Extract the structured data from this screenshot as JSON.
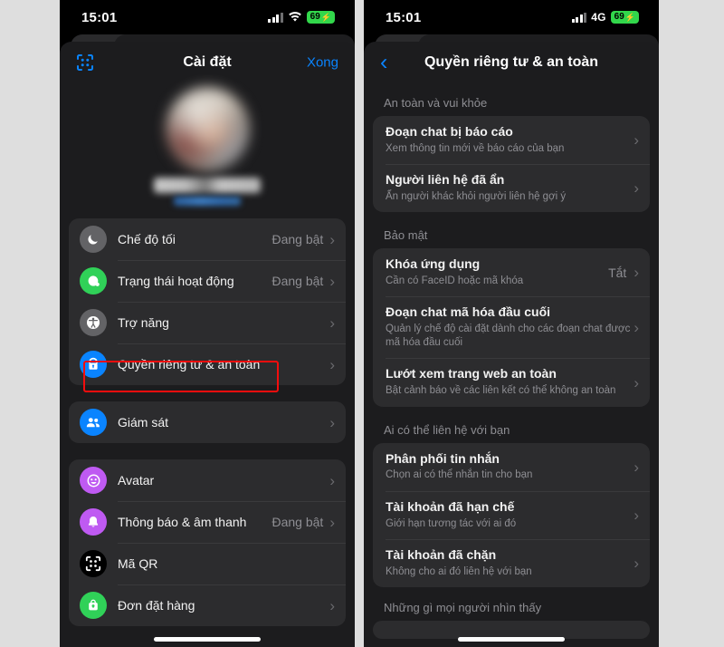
{
  "background_color": "#dedede",
  "left_phone": {
    "status_bar": {
      "time": "15:01",
      "network": "",
      "battery": "69",
      "battery_charging": true,
      "signal_icon": "cellular-signal-icon",
      "wifi_icon": "wifi-icon",
      "battery_icon": "battery-icon"
    },
    "nav": {
      "left_icon": "qr-code-icon",
      "title": "Cài đặt",
      "right_label": "Xong"
    },
    "profile": {
      "avatar": "blurred-profile-photo",
      "name": "blurred-name",
      "handle": "blurred-username"
    },
    "groups": [
      {
        "rows": [
          {
            "icon": "moon-icon",
            "icon_color": "#636366",
            "label": "Chế độ tối",
            "value": "Đang bật",
            "chevron": "chevron-right-icon"
          },
          {
            "icon": "active-status-icon",
            "icon_color": "#30d158",
            "label": "Trạng thái hoạt động",
            "value": "Đang bật",
            "chevron": "chevron-right-icon"
          },
          {
            "icon": "accessibility-icon",
            "icon_color": "#636366",
            "label": "Trợ năng",
            "value": "",
            "chevron": "chevron-right-icon"
          },
          {
            "icon": "privacy-lock-icon",
            "icon_color": "#0a84ff",
            "label": "Quyền riêng tư & an toàn",
            "value": "",
            "chevron": "chevron-right-icon"
          }
        ]
      },
      {
        "rows": [
          {
            "icon": "supervision-icon",
            "icon_color": "#0a84ff",
            "label": "Giám sát",
            "value": "",
            "chevron": "chevron-right-icon"
          }
        ]
      },
      {
        "rows": [
          {
            "icon": "avatar-icon",
            "icon_color": "#bf5af2",
            "label": "Avatar",
            "value": "",
            "chevron": "chevron-right-icon"
          },
          {
            "icon": "bell-icon",
            "icon_color": "#bf5af2",
            "label": "Thông báo & âm thanh",
            "value": "Đang bật",
            "chevron": "chevron-right-icon"
          },
          {
            "icon": "qr-code-icon",
            "icon_color": "#000000",
            "label": "Mã QR",
            "value": "",
            "chevron": ""
          },
          {
            "icon": "shopping-bag-icon",
            "icon_color": "#30d158",
            "label": "Đơn đặt hàng",
            "value": "",
            "chevron": "chevron-right-icon"
          }
        ]
      }
    ],
    "highlight": {
      "target": "Quyền riêng tư & an toàn",
      "color": "#f40d0d"
    }
  },
  "right_phone": {
    "status_bar": {
      "time": "15:01",
      "network": "4G",
      "battery": "69",
      "battery_charging": true,
      "signal_icon": "cellular-signal-icon",
      "battery_icon": "battery-icon"
    },
    "nav": {
      "back_icon": "chevron-left-icon",
      "title": "Quyền riêng tư & an toàn"
    },
    "sections": [
      {
        "header": "An toàn và vui khỏe",
        "rows": [
          {
            "title": "Đoạn chat bị báo cáo",
            "sub": "Xem thông tin mới về báo cáo của bạn",
            "value": "",
            "chevron": "chevron-right-icon"
          },
          {
            "title": "Người liên hệ đã ẩn",
            "sub": "Ẩn người khác khỏi người liên hệ gợi ý",
            "value": "",
            "chevron": "chevron-right-icon"
          }
        ]
      },
      {
        "header": "Bảo mật",
        "rows": [
          {
            "title": "Khóa ứng dụng",
            "sub": "Cần có FaceID hoặc mã khóa",
            "value": "Tắt",
            "chevron": "chevron-right-icon"
          },
          {
            "title": "Đoạn chat mã hóa đầu cuối",
            "sub": "Quản lý chế độ cài đặt dành cho các đoạn chat được mã hóa đầu cuối",
            "value": "",
            "chevron": "chevron-right-icon"
          },
          {
            "title": "Lướt xem trang web an toàn",
            "sub": "Bật cảnh báo về các liên kết có thể không an toàn",
            "value": "",
            "chevron": "chevron-right-icon"
          }
        ]
      },
      {
        "header": "Ai có thể liên hệ với bạn",
        "rows": [
          {
            "title": "Phân phối tin nhắn",
            "sub": "Chọn ai có thể nhắn tin cho bạn",
            "value": "",
            "chevron": "chevron-right-icon"
          },
          {
            "title": "Tài khoản đã hạn chế",
            "sub": "Giới hạn tương tác với ai đó",
            "value": "",
            "chevron": "chevron-right-icon"
          },
          {
            "title": "Tài khoản đã chặn",
            "sub": "Không cho ai đó liên hệ với bạn",
            "value": "",
            "chevron": "chevron-right-icon"
          }
        ]
      },
      {
        "header": "Những gì mọi người nhìn thấy",
        "rows": []
      }
    ],
    "highlight": {
      "target": "Đoạn chat mã hóa đầu cuối",
      "color": "#f40d0d"
    }
  }
}
